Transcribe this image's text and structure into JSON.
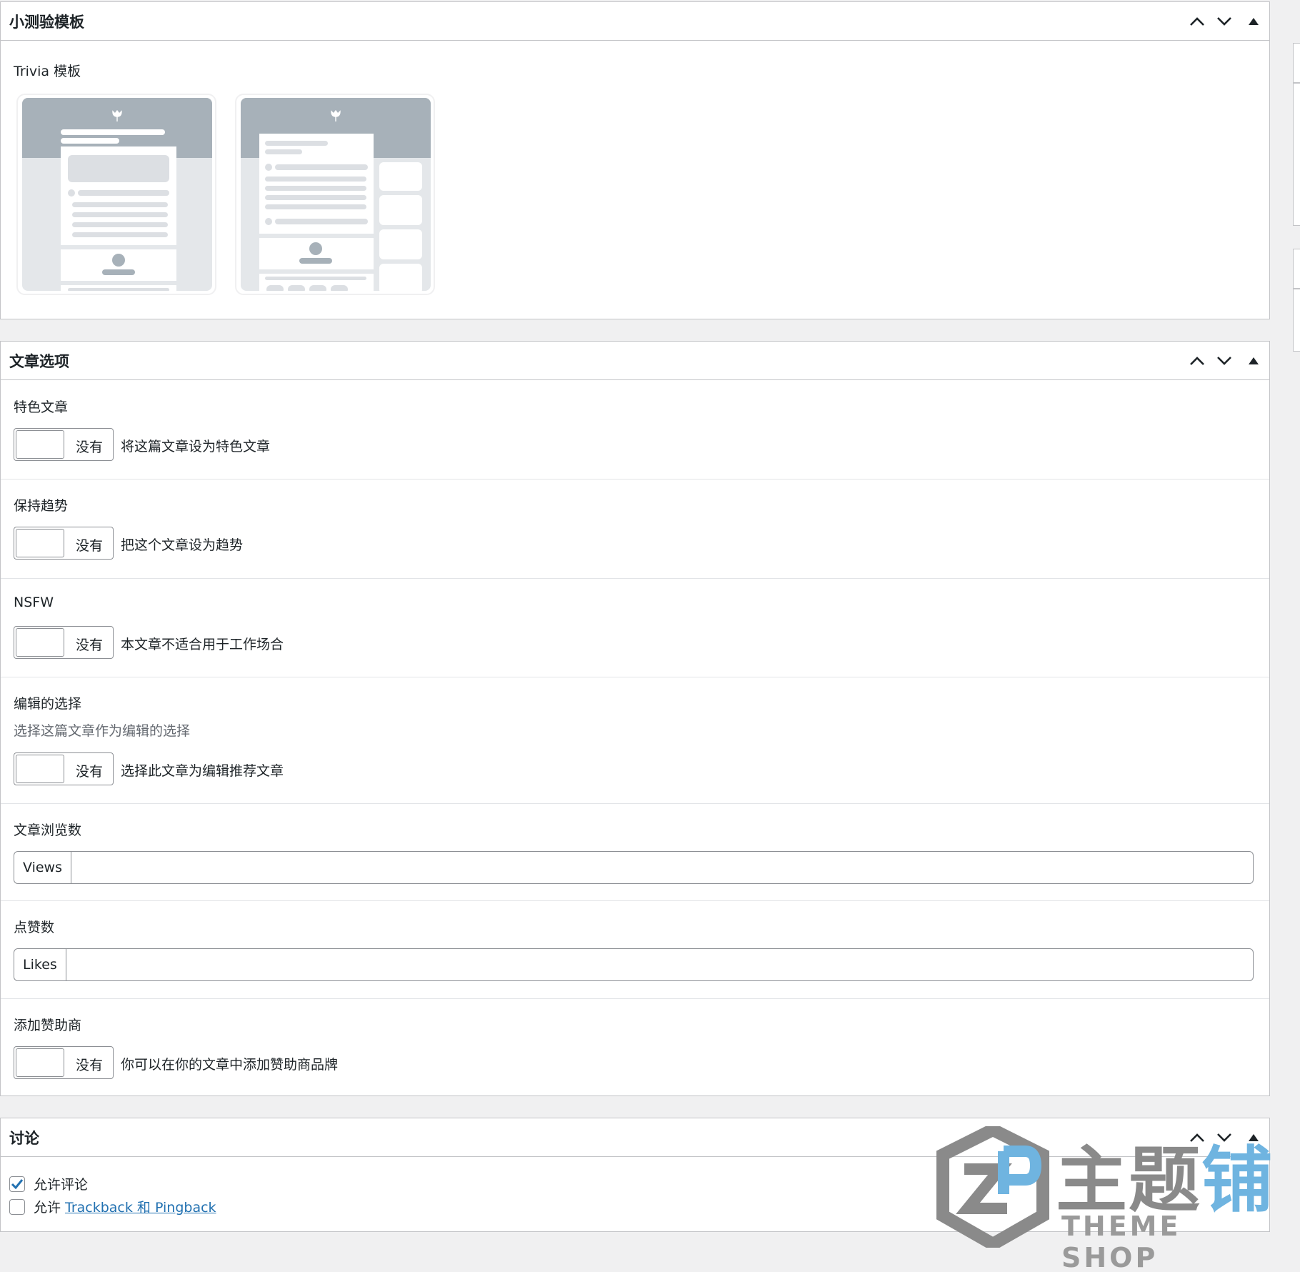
{
  "colors": {
    "link": "#2271b1",
    "border": "#c3c4c7",
    "page_bg": "#f0f0f1",
    "template_gray": "#a7b1b9",
    "watermark_blue": "#6fb4e0"
  },
  "icons": {
    "move_up": "chevron-up-icon",
    "move_down": "chevron-down-icon",
    "toggle_panel": "triangle-up-icon",
    "template_logo": "tulip-icon",
    "check": "check-icon"
  },
  "quiz_template": {
    "title": "小测验模板",
    "label": "Trivia 模板",
    "templates": [
      {
        "id": "layout-1"
      },
      {
        "id": "layout-2"
      }
    ]
  },
  "post_options": {
    "title": "文章选项",
    "featured": {
      "title": "特色文章",
      "toggle_label": "没有",
      "desc": "将这篇文章设为特色文章"
    },
    "trending": {
      "title": "保持趋势",
      "toggle_label": "没有",
      "desc": "把这个文章设为趋势"
    },
    "nsfw": {
      "title": "NSFW",
      "toggle_label": "没有",
      "desc": "本文章不适合用于工作场合"
    },
    "editors_pick": {
      "title": "编辑的选择",
      "subtitle": "选择这篇文章作为编辑的选择",
      "toggle_label": "没有",
      "desc": "选择此文章为编辑推荐文章"
    },
    "views": {
      "title": "文章浏览数",
      "prefix": "Views",
      "value": ""
    },
    "likes": {
      "title": "点赞数",
      "prefix": "Likes",
      "value": ""
    },
    "sponsor": {
      "title": "添加赞助商",
      "toggle_label": "没有",
      "desc": "你可以在你的文章中添加赞助商品牌"
    }
  },
  "discussion": {
    "title": "讨论",
    "allow_comments": {
      "label": "允许评论",
      "checked": true
    },
    "allow_pings": {
      "label": "允许",
      "link": "Trackback 和 Pingback",
      "checked": false
    }
  },
  "watermark": {
    "text_gray": "主题",
    "text_blue": "铺",
    "subtitle": "THEME SHOP"
  }
}
